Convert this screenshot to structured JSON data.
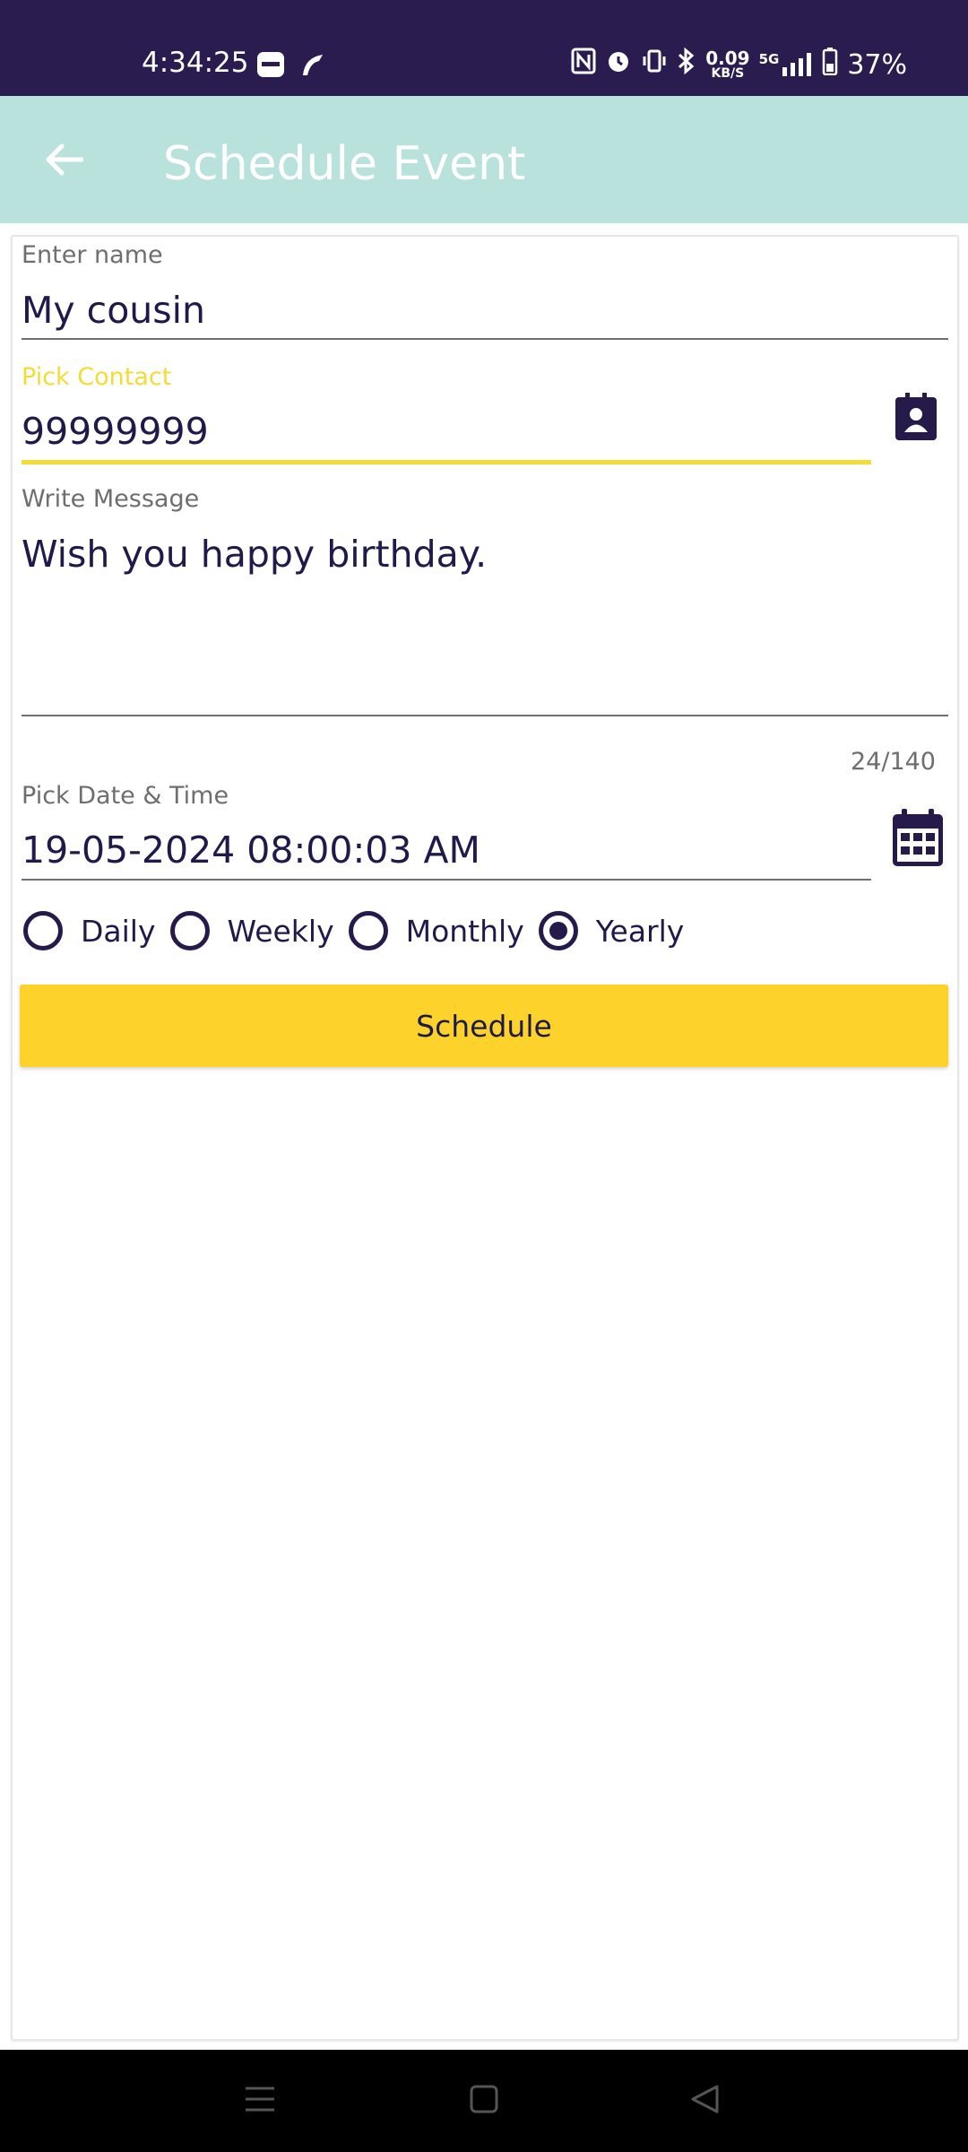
{
  "status_bar": {
    "time": "4:34:25",
    "network_speed_value": "0.09",
    "network_speed_unit": "KB/S",
    "network_type": "5G",
    "battery": "37%"
  },
  "app_bar": {
    "title": "Schedule Event"
  },
  "form": {
    "name": {
      "label": "Enter name",
      "value": "My cousin"
    },
    "contact": {
      "label": "Pick Contact",
      "value": "99999999"
    },
    "message": {
      "label": "Write Message",
      "value": "Wish you happy birthday.",
      "counter": "24/140"
    },
    "datetime": {
      "label": "Pick Date & Time",
      "value": "19-05-2024 08:00:03 AM"
    },
    "repeat_options": [
      {
        "label": "Daily",
        "selected": false
      },
      {
        "label": "Weekly",
        "selected": false
      },
      {
        "label": "Monthly",
        "selected": false
      },
      {
        "label": "Yearly",
        "selected": true
      }
    ],
    "schedule_label": "Schedule"
  },
  "colors": {
    "status_bar": "#2b1c4f",
    "app_bar": "#b9e2dd",
    "accent_yellow": "#fdd32b",
    "focus_label": "#f2dc36",
    "ink": "#1f1a4a"
  }
}
